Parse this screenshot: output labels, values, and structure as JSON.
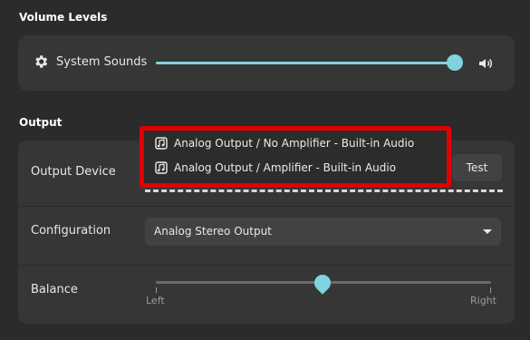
{
  "volume": {
    "title": "Volume Levels",
    "system_sounds_label": "System Sounds",
    "system_sounds_level": 1.0
  },
  "output": {
    "title": "Output",
    "device_label": "Output Device",
    "test_label": "Test",
    "device_options": [
      {
        "label": "Analog Output / No Amplifier - Built-in Audio"
      },
      {
        "label": "Analog Output / Amplifier - Built-in Audio"
      }
    ],
    "configuration_label": "Configuration",
    "configuration_value": "Analog Stereo Output",
    "balance_label": "Balance",
    "balance_left": "Left",
    "balance_right": "Right",
    "balance_value": 0.5
  },
  "colors": {
    "accent": "#7ed3de",
    "highlight_border": "#e00000",
    "background": "#2b2b2b",
    "card": "#363636"
  }
}
